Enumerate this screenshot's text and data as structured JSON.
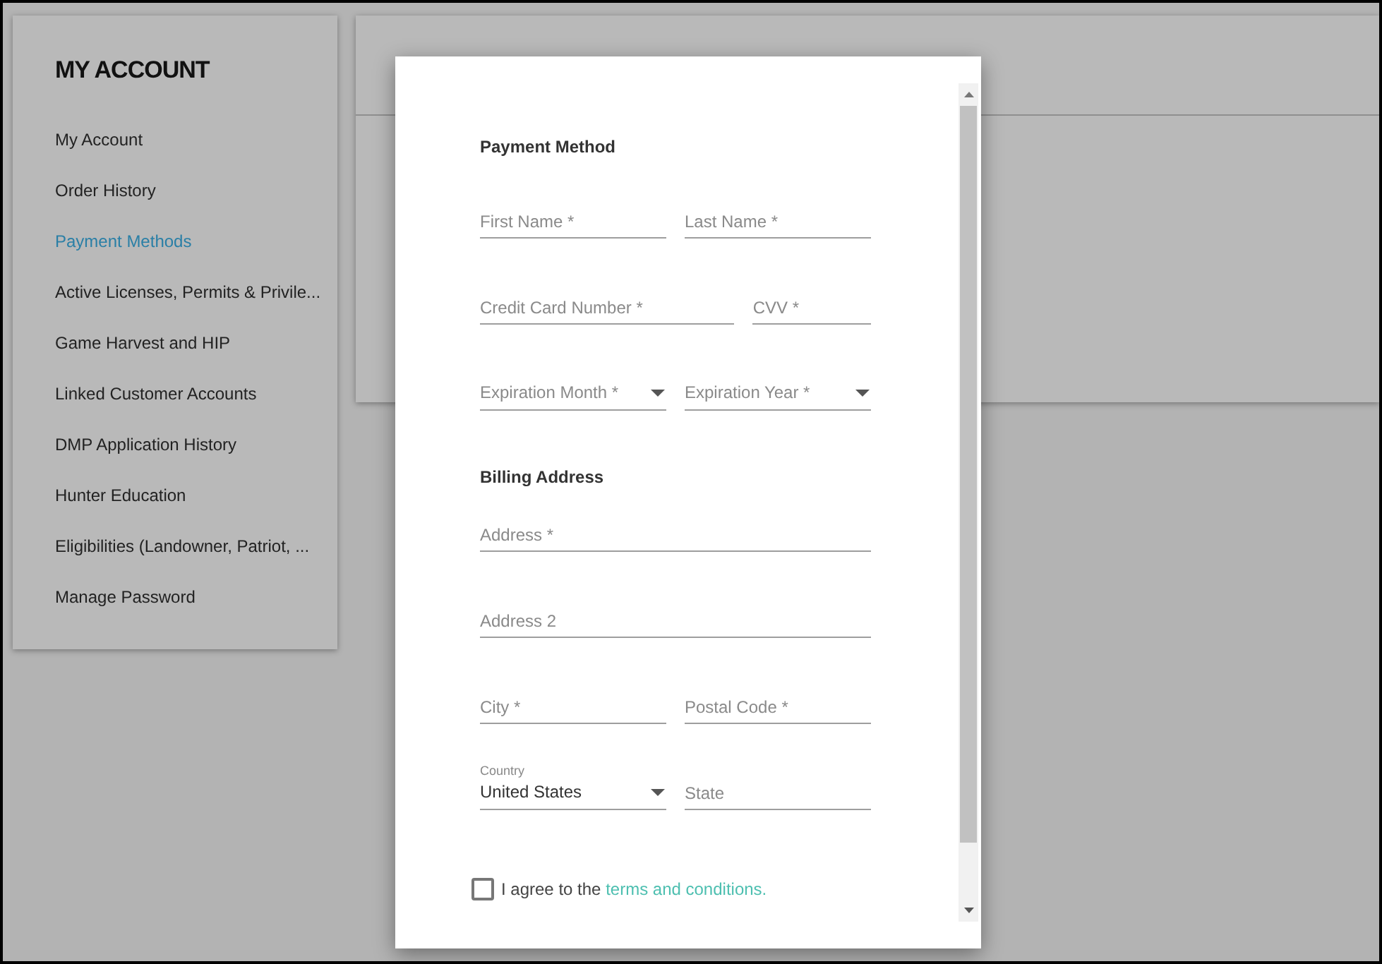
{
  "sidebar": {
    "title": "MY ACCOUNT",
    "items": [
      {
        "label": "My Account",
        "selected": false
      },
      {
        "label": "Order History",
        "selected": false
      },
      {
        "label": "Payment Methods",
        "selected": true
      },
      {
        "label": "Active Licenses, Permits & Privile...",
        "selected": false
      },
      {
        "label": "Game Harvest and HIP",
        "selected": false
      },
      {
        "label": "Linked Customer Accounts",
        "selected": false
      },
      {
        "label": "DMP Application History",
        "selected": false
      },
      {
        "label": "Hunter Education",
        "selected": false
      },
      {
        "label": "Eligibilities (Landowner, Patriot, ...",
        "selected": false
      },
      {
        "label": "Manage Password",
        "selected": false
      }
    ]
  },
  "dialog": {
    "sections": [
      {
        "title": "Payment Method",
        "rows": [
          [
            {
              "kind": "text",
              "placeholder": "First Name *"
            },
            {
              "kind": "text",
              "placeholder": "Last Name *"
            }
          ],
          [
            {
              "kind": "text",
              "placeholder": "Credit Card Number *"
            },
            {
              "kind": "text",
              "placeholder": "CVV *"
            }
          ],
          [
            {
              "kind": "select",
              "placeholder": "Expiration Month *"
            },
            {
              "kind": "select",
              "placeholder": "Expiration Year *"
            }
          ]
        ]
      },
      {
        "title": "Billing Address",
        "rows": [
          [
            {
              "kind": "text",
              "placeholder": "Address *"
            }
          ],
          [
            {
              "kind": "text",
              "placeholder": "Address 2"
            }
          ],
          [
            {
              "kind": "text",
              "placeholder": "City *"
            },
            {
              "kind": "text",
              "placeholder": "Postal Code *"
            }
          ],
          [
            {
              "kind": "select",
              "label": "Country",
              "value": "United States"
            },
            {
              "kind": "text",
              "placeholder": "State"
            }
          ]
        ]
      }
    ],
    "agreement": {
      "checked": false,
      "text": "I agree to the",
      "link": "terms and conditions."
    }
  }
}
